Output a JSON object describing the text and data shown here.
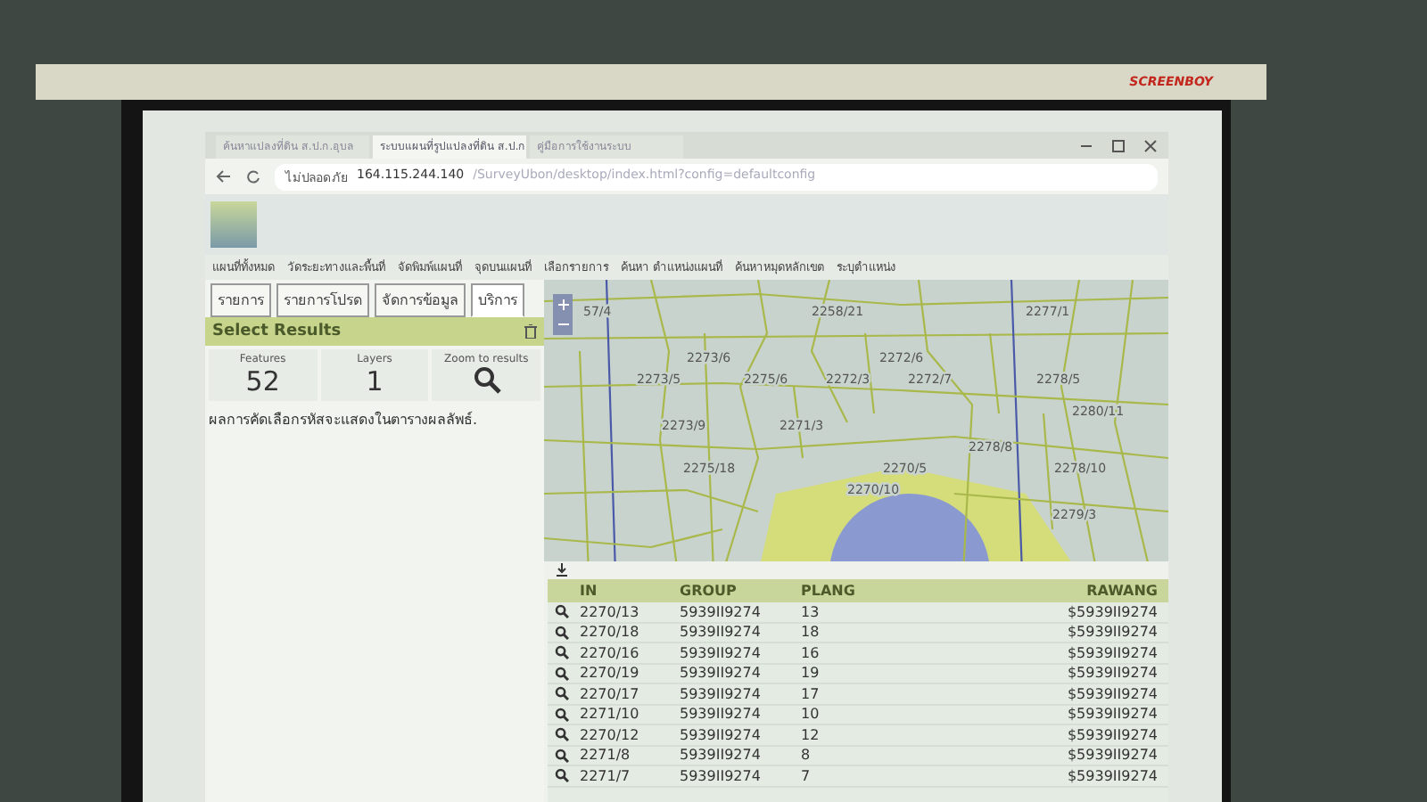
{
  "screen_brand": "SCREENBOY",
  "browser": {
    "tabs": [
      {
        "title": "ค้นหาแปลงที่ดิน ส.ป.ก.อุบล",
        "selected": false
      },
      {
        "title": "ระบบแผนที่รูปแปลงที่ดิน ส.ป.ก.",
        "selected": true
      },
      {
        "title": "คู่มือการใช้งานระบบ",
        "selected": false
      }
    ],
    "security": "ไม่ปลอดภัย",
    "host": "164.115.244.140",
    "path": "/SurveyUbon/desktop/index.html?config=defaultconfig"
  },
  "toolbar": [
    "แผนที่ทั้งหมด",
    "วัดระยะทางและพื้นที่",
    "จัดพิมพ์แผนที่",
    "จุดบนแผนที่",
    "เลือกรายการ",
    "ค้นหา ตำแหน่งแผนที่",
    "ค้นหาหมุดหลักเขต",
    "ระบุตำแหน่ง"
  ],
  "panel_tabs": [
    {
      "label": "รายการ",
      "selected": false
    },
    {
      "label": "รายการโปรด",
      "selected": false
    },
    {
      "label": "จัดการข้อมูล",
      "selected": false
    },
    {
      "label": "บริการ",
      "selected": true
    }
  ],
  "select_results": {
    "title": "Select Results",
    "features_label": "Features",
    "features": "52",
    "layers_label": "Layers",
    "layers": "1",
    "zoom_label": "Zoom to results",
    "message": "ผลการคัดเลือกรหัสจะแสดงในตารางผลลัพธ์."
  },
  "map": {
    "labels": [
      "57/4",
      "2258/21",
      "2277/1",
      "2273/6",
      "2272/6",
      "2273/5",
      "2275/6",
      "2272/3",
      "2272/7",
      "2278/5",
      "2280/11",
      "2273/9",
      "2271/3",
      "2278/8",
      "2275/18",
      "2270/5",
      "2278/10",
      "2270/10",
      "2279/3"
    ]
  },
  "table": {
    "columns": [
      "IN",
      "GROUP",
      "PLANG",
      "RAWANG"
    ],
    "rows": [
      [
        "2270/13",
        "5939II9274",
        "13",
        "$5939II9274"
      ],
      [
        "2270/18",
        "5939II9274",
        "18",
        "$5939II9274"
      ],
      [
        "2270/16",
        "5939II9274",
        "16",
        "$5939II9274"
      ],
      [
        "2270/19",
        "5939II9274",
        "19",
        "$5939II9274"
      ],
      [
        "2270/17",
        "5939II9274",
        "17",
        "$5939II9274"
      ],
      [
        "2271/10",
        "5939II9274",
        "10",
        "$5939II9274"
      ],
      [
        "2270/12",
        "5939II9274",
        "12",
        "$5939II9274"
      ],
      [
        "2271/8",
        "5939II9274",
        "8",
        "$5939II9274"
      ],
      [
        "2271/7",
        "5939II9274",
        "7",
        "$5939II9274"
      ]
    ]
  }
}
